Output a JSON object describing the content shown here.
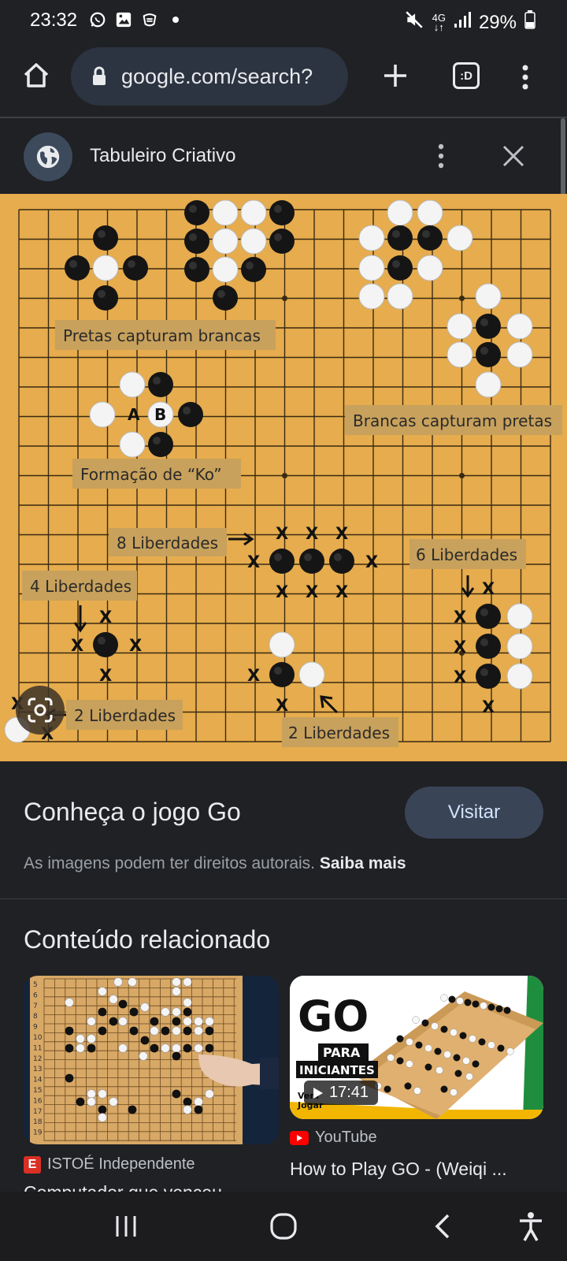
{
  "status_bar": {
    "time": "23:32",
    "battery": "29%",
    "network": "4G",
    "left_icons": [
      "whatsapp-icon",
      "gallery-icon",
      "app-icon",
      "dot-icon"
    ],
    "right_icons": [
      "mute-icon",
      "network-4g-icon",
      "signal-icon",
      "battery-icon"
    ]
  },
  "browser": {
    "url": "google.com/search?",
    "tabs_label": ":D"
  },
  "viewer": {
    "site_name": "Tabuleiro Criativo"
  },
  "image_labels": {
    "pretas_capturam": "Pretas capturam brancas",
    "brancas_capturam": "Brancas capturam pretas",
    "ko": "Formação de “Ko”",
    "lib8": "8 Liberdades",
    "lib6": "6 Liberdades",
    "lib4": "4 Liberdades",
    "lib2a": "2 Liberdades",
    "lib2b": "2 Liberdades",
    "mark_a": "A",
    "mark_b": "B",
    "x": "X"
  },
  "info": {
    "title": "Conheça o jogo Go",
    "visit_label": "Visitar",
    "rights_text": "As imagens podem ter direitos autorais.",
    "rights_link": "Saiba mais"
  },
  "related": {
    "title": "Conteúdo relacionado",
    "items": [
      {
        "source": "ISTOÉ Independente",
        "source_badge": "E",
        "caption": "Computador que venceu",
        "row_numbers": [
          "5",
          "6",
          "7",
          "8",
          "9",
          "10",
          "11",
          "12",
          "13",
          "14",
          "15",
          "16",
          "17",
          "18",
          "19"
        ]
      },
      {
        "source": "YouTube",
        "caption": "How to Play GO - (Weiqi ...",
        "duration": "17:41",
        "thumb_title": "GO",
        "thumb_sub": "PARA",
        "thumb_sub2": "INICIANTES",
        "thumb_brand_1": "Vem",
        "thumb_brand_2": "Jogar"
      }
    ]
  },
  "colors": {
    "background": "#202124",
    "board": "#e6ac4d",
    "label_box": "#c8a15c",
    "visit_button": "#394457"
  }
}
